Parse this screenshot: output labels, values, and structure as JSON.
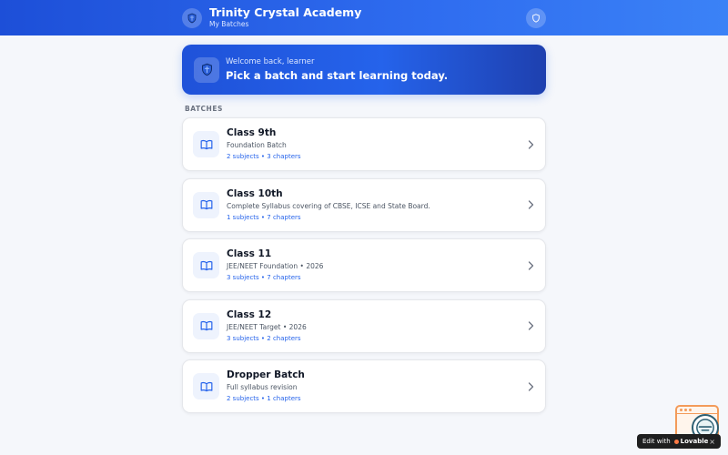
{
  "header": {
    "title": "Trinity Crystal Academy",
    "subtitle": "My Batches",
    "logo_icon": "shield-logo-icon",
    "action_icon": "shield-icon"
  },
  "hero": {
    "kicker": "Welcome back, learner",
    "title": "Pick a batch and start learning today.",
    "icon": "shield-logo-icon"
  },
  "section": {
    "label": "BATCHES"
  },
  "batches": [
    {
      "title": "Class 9th",
      "description": "Foundation Batch",
      "meta": "2 subjects • 3 chapters"
    },
    {
      "title": "Class 10th",
      "description": "Complete Syllabus covering of CBSE, ICSE and State Board.",
      "meta": "1 subjects • 7 chapters"
    },
    {
      "title": "Class 11",
      "description": "JEE/NEET Foundation • 2026",
      "meta": "3 subjects • 7 chapters"
    },
    {
      "title": "Class 12",
      "description": "JEE/NEET Target • 2026",
      "meta": "3 subjects • 2 chapters"
    },
    {
      "title": "Dropper Batch",
      "description": "Full syllabus revision",
      "meta": "2 subjects • 1 chapters"
    }
  ],
  "edit_badge": {
    "prefix": "Edit with",
    "brand": "Lovable",
    "close": "×"
  },
  "colors": {
    "primary": "#2563eb",
    "primary_dark": "#1e40af",
    "page_bg": "#f5f7fb",
    "card_bg": "#ffffff",
    "meta_text": "#2563eb",
    "widget_accent": "#f39b5a"
  }
}
